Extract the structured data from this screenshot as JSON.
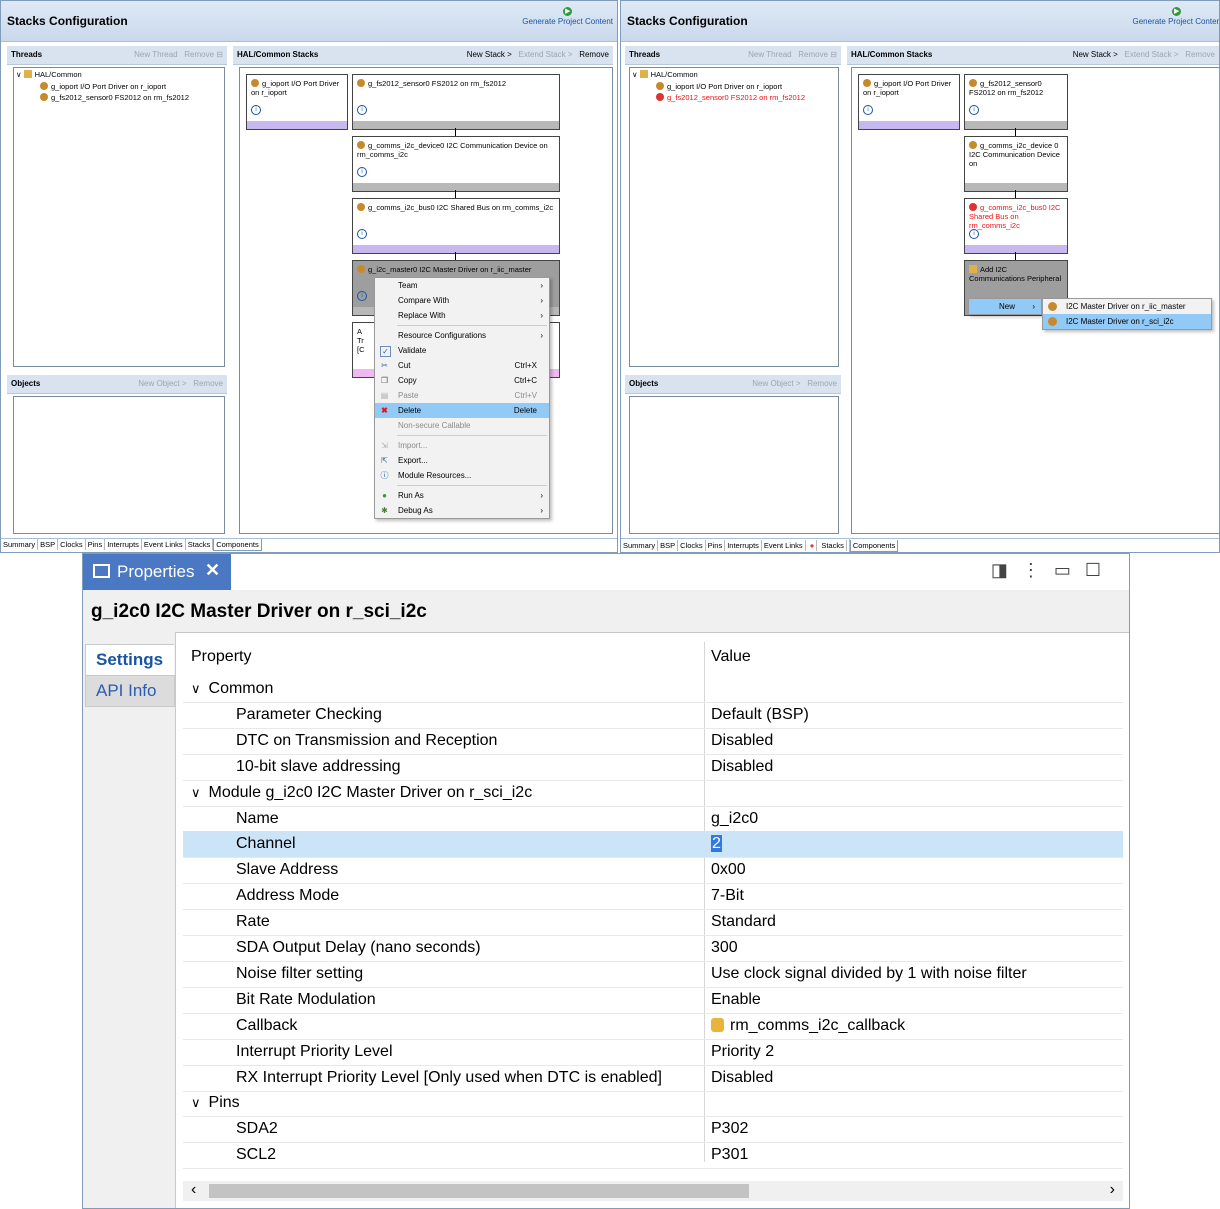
{
  "left_panel": {
    "title": "Stacks Configuration",
    "generate": "Generate Project Content",
    "threads": {
      "title": "Threads",
      "new_thread": "New Thread",
      "remove": "Remove"
    },
    "hal": {
      "title": "HAL/Common Stacks",
      "new_stack": "New Stack >",
      "extend_stack": "Extend Stack >",
      "remove": "Remove"
    },
    "tree": {
      "root": "HAL/Common",
      "items": [
        "g_ioport I/O Port Driver on r_ioport",
        "g_fs2012_sensor0 FS2012 on rm_fs2012"
      ]
    },
    "objects": {
      "title": "Objects",
      "new_object": "New Object >",
      "remove": "Remove"
    },
    "blocks": {
      "ioport": "g_ioport I/O Port Driver on r_ioport",
      "fs2012": "g_fs2012_sensor0 FS2012 on rm_fs2012",
      "device": "g_comms_i2c_device0 I2C Communication Device on rm_comms_i2c",
      "bus": "g_comms_i2c_bus0 I2C Shared Bus on rm_comms_i2c",
      "master": "g_i2c_master0 I2C Master Driver on r_iic_master",
      "add_partial": "A\nTr\n[C"
    },
    "context_menu": {
      "team": "Team",
      "compare": "Compare With",
      "replace": "Replace With",
      "resource": "Resource Configurations",
      "validate": "Validate",
      "cut": "Cut",
      "cut_key": "Ctrl+X",
      "copy": "Copy",
      "copy_key": "Ctrl+C",
      "paste": "Paste",
      "paste_key": "Ctrl+V",
      "delete": "Delete",
      "delete_key": "Delete",
      "nonsecure": "Non-secure Callable",
      "import": "Import...",
      "export": "Export...",
      "module_resources": "Module Resources...",
      "run_as": "Run As",
      "debug_as": "Debug As"
    },
    "tabs": [
      "Summary",
      "BSP",
      "Clocks",
      "Pins",
      "Interrupts",
      "Event Links",
      "Stacks",
      "Components"
    ]
  },
  "right_panel": {
    "title": "Stacks Configuration",
    "generate": "Generate Project Conten",
    "threads": {
      "title": "Threads",
      "new_thread": "New Thread",
      "remove": "Remove"
    },
    "hal": {
      "title": "HAL/Common Stacks",
      "new_stack": "New Stack >",
      "extend_stack": "Extend Stack >",
      "remove": "Remove"
    },
    "tree": {
      "root": "HAL/Common",
      "items": [
        "g_ioport I/O Port Driver on r_ioport",
        "g_fs2012_sensor0 FS2012 on rm_fs2012"
      ]
    },
    "objects": {
      "title": "Objects",
      "new_object": "New Object >",
      "remove": "Remove"
    },
    "blocks": {
      "ioport": "g_ioport I/O Port Driver on r_ioport",
      "fs2012": "g_fs2012_sensor0 FS2012 on rm_fs2012",
      "device": "g_comms_i2c_device 0 I2C Communication Device on",
      "bus": "g_comms_i2c_bus0 I2C Shared Bus on rm_comms_i2c",
      "add": "Add I2C Communications Peripheral"
    },
    "new_menu": {
      "new": "New",
      "opt1": "I2C Master Driver on r_iic_master",
      "opt2": "I2C Master Driver on r_sci_i2c"
    },
    "tabs": [
      "Summary",
      "BSP",
      "Clocks",
      "Pins",
      "Interrupts",
      "Event Links",
      "Stacks",
      "Components"
    ]
  },
  "properties": {
    "tab_label": "Properties",
    "close": "✕",
    "heading": "g_i2c0 I2C Master Driver on r_sci_i2c",
    "side_tabs": [
      "Settings",
      "API Info"
    ],
    "col_property": "Property",
    "col_value": "Value",
    "rows": [
      {
        "p": "Common",
        "v": "",
        "group": true
      },
      {
        "p": "Parameter Checking",
        "v": "Default (BSP)"
      },
      {
        "p": "DTC on Transmission and Reception",
        "v": "Disabled"
      },
      {
        "p": "10-bit slave addressing",
        "v": "Disabled"
      },
      {
        "p": "Module g_i2c0 I2C Master Driver on r_sci_i2c",
        "v": "",
        "group": true
      },
      {
        "p": "Name",
        "v": "g_i2c0"
      },
      {
        "p": "Channel",
        "v": "2",
        "selected": true
      },
      {
        "p": "Slave Address",
        "v": "0x00"
      },
      {
        "p": "Address Mode",
        "v": "7-Bit"
      },
      {
        "p": "Rate",
        "v": "Standard"
      },
      {
        "p": "SDA Output Delay (nano seconds)",
        "v": "300"
      },
      {
        "p": "Noise filter setting",
        "v": "Use clock signal divided by 1 with noise filter"
      },
      {
        "p": "Bit Rate Modulation",
        "v": "Enable"
      },
      {
        "p": "Callback",
        "v": "rm_comms_i2c_callback",
        "locked": true
      },
      {
        "p": "Interrupt Priority Level",
        "v": "Priority 2"
      },
      {
        "p": "RX Interrupt Priority Level [Only used when DTC is enabled]",
        "v": "Disabled"
      },
      {
        "p": "Pins",
        "v": "",
        "group": true
      },
      {
        "p": "SDA2",
        "v": "P302"
      },
      {
        "p": "SCL2",
        "v": "P301"
      }
    ]
  }
}
